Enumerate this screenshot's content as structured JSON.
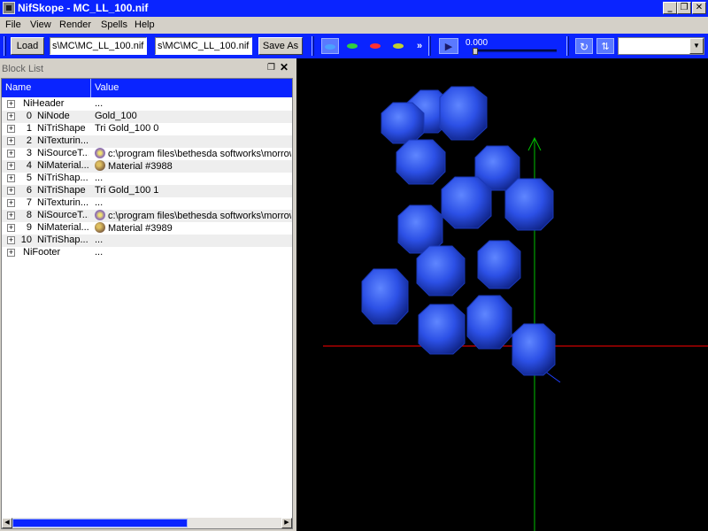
{
  "window": {
    "title": "NifSkope - MC_LL_100.nif"
  },
  "menu": [
    "File",
    "View",
    "Render",
    "Spells",
    "Help"
  ],
  "toolbar": {
    "load_label": "Load",
    "load_path": "s\\MC\\MC_LL_100.nif",
    "save_path": "s\\MC\\MC_LL_100.nif",
    "save_label": "Save As",
    "more_label": "»",
    "time_value": "0.000",
    "view_select": ""
  },
  "block_list": {
    "title": "Block List",
    "columns": [
      "Name",
      "Value"
    ],
    "rows": [
      {
        "num": "",
        "name": "NiHeader",
        "value": "...",
        "icon": ""
      },
      {
        "num": "0",
        "name": "NiNode",
        "value": "Gold_100",
        "icon": ""
      },
      {
        "num": "1",
        "name": "NiTriShape",
        "value": "Tri Gold_100 0",
        "icon": ""
      },
      {
        "num": "2",
        "name": "NiTexturin...",
        "value": "",
        "icon": ""
      },
      {
        "num": "3",
        "name": "NiSourceT...",
        "value": "c:\\program files\\bethesda softworks\\morrowind\\",
        "icon": "texture-icon"
      },
      {
        "num": "4",
        "name": "NiMaterial...",
        "value": "Material #3988",
        "icon": "material-icon"
      },
      {
        "num": "5",
        "name": "NiTriShap...",
        "value": "...",
        "icon": ""
      },
      {
        "num": "6",
        "name": "NiTriShape",
        "value": "Tri Gold_100 1",
        "icon": ""
      },
      {
        "num": "7",
        "name": "NiTexturin...",
        "value": "...",
        "icon": ""
      },
      {
        "num": "8",
        "name": "NiSourceT...",
        "value": "c:\\program files\\bethesda softworks\\morrowind\\",
        "icon": "texture-icon"
      },
      {
        "num": "9",
        "name": "NiMaterial...",
        "value": "Material #3989",
        "icon": "material-icon"
      },
      {
        "num": "10",
        "name": "NiTriShap...",
        "value": "...",
        "icon": ""
      },
      {
        "num": "",
        "name": "NiFooter",
        "value": "...",
        "icon": ""
      }
    ]
  },
  "colors": {
    "accent": "#0a24ff",
    "viewport_bg": "#000000",
    "axis_x": "#ff0000",
    "axis_y": "#00c000",
    "gem": "#2c50e6"
  }
}
